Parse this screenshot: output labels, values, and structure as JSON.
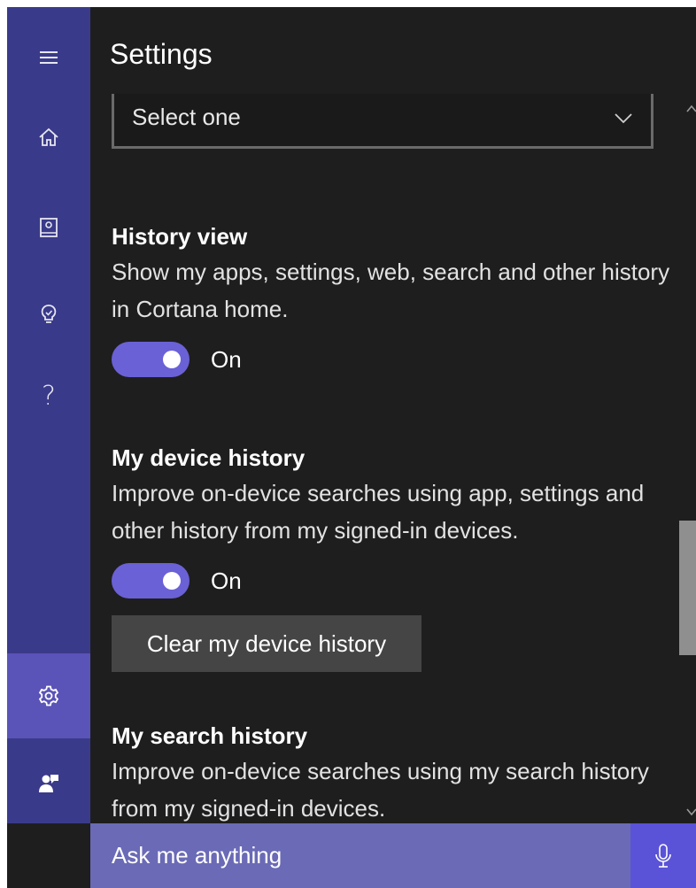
{
  "app": {
    "title": "Settings",
    "colors": {
      "rail": "#3a3a8a",
      "rail_selected": "#5a53b8",
      "panel": "#1e1e1e",
      "toggle_on": "#6a61d6",
      "search_bar": "#6a6ab6",
      "mic": "#5a53d8"
    }
  },
  "rail": {
    "items": [
      {
        "icon": "hamburger-menu-icon"
      },
      {
        "icon": "home-icon"
      },
      {
        "icon": "notebook-icon"
      },
      {
        "icon": "lightbulb-icon"
      },
      {
        "icon": "help-icon",
        "glyph": "?"
      },
      {
        "icon": "gear-icon",
        "selected": true
      },
      {
        "icon": "feedback-icon"
      }
    ]
  },
  "dropdown": {
    "value": "Select one"
  },
  "sections": [
    {
      "heading": "History view",
      "description": "Show my apps, settings, web, search and other history in Cortana home.",
      "toggle": {
        "state": "On",
        "on": true
      }
    },
    {
      "heading": "My device history",
      "description": "Improve on-device searches using app, settings and other history from my signed-in devices.",
      "toggle": {
        "state": "On",
        "on": true
      },
      "button": "Clear my device history"
    },
    {
      "heading": "My search history",
      "description": "Improve on-device searches using my search history from my signed-in devices."
    }
  ],
  "search": {
    "placeholder": "Ask me anything",
    "mic_icon": "microphone-icon"
  }
}
